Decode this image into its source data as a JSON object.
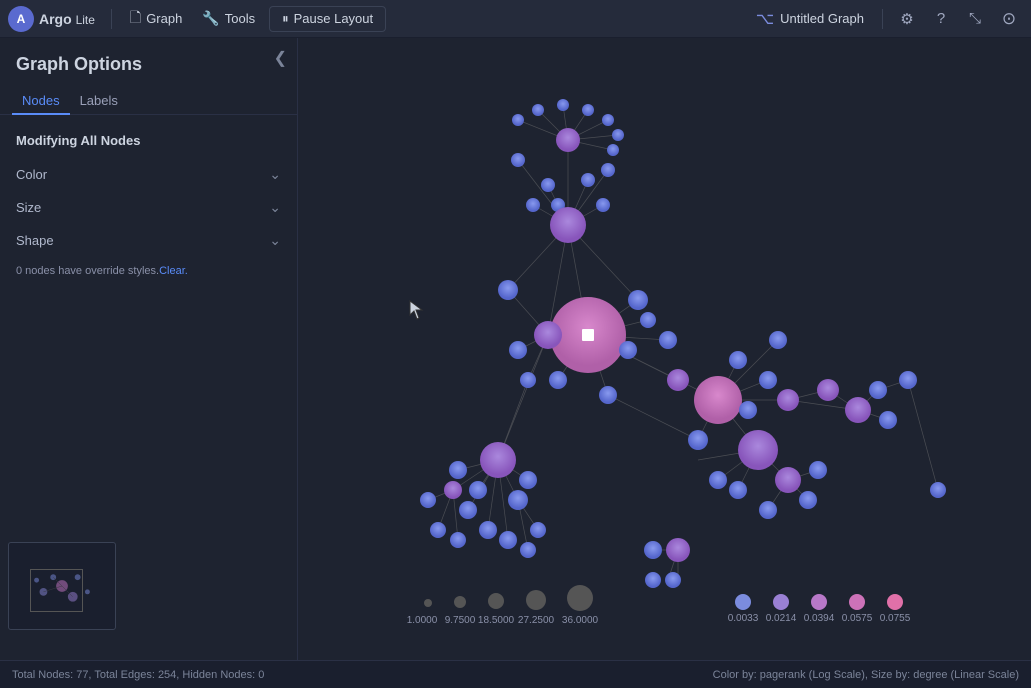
{
  "app": {
    "logo_text": "Argo",
    "logo_sub": "Lite"
  },
  "topnav": {
    "graph_label": "Graph",
    "tools_label": "Tools",
    "pause_layout_label": "Pause Layout",
    "untitled_graph_label": "Untitled Graph"
  },
  "sidebar": {
    "title": "Graph Options",
    "collapse_icon": "❮",
    "tabs": [
      {
        "id": "nodes",
        "label": "Nodes",
        "active": true
      },
      {
        "id": "labels",
        "label": "Labels",
        "active": false
      }
    ],
    "section_title": "Modifying All Nodes",
    "options": [
      {
        "id": "color",
        "label": "Color"
      },
      {
        "id": "size",
        "label": "Size"
      },
      {
        "id": "shape",
        "label": "Shape"
      }
    ],
    "override_text": "0 nodes have override styles.",
    "override_link": "Clear."
  },
  "bottombar": {
    "left": "Total Nodes: 77, Total Edges: 254, Hidden Nodes: 0",
    "right": "Color by: pagerank (Log Scale), Size by: degree (Linear Scale)"
  },
  "legend": {
    "size_labels": [
      "1.0000",
      "9.7500",
      "18.5000",
      "27.2500",
      "36.0000"
    ],
    "color_labels": [
      "0.0033",
      "0.0214",
      "0.0394",
      "0.0575",
      "0.0755"
    ],
    "color_values": [
      "#7b8cde",
      "#9a80d4",
      "#b878c8",
      "#d070bc",
      "#e868b0"
    ]
  }
}
